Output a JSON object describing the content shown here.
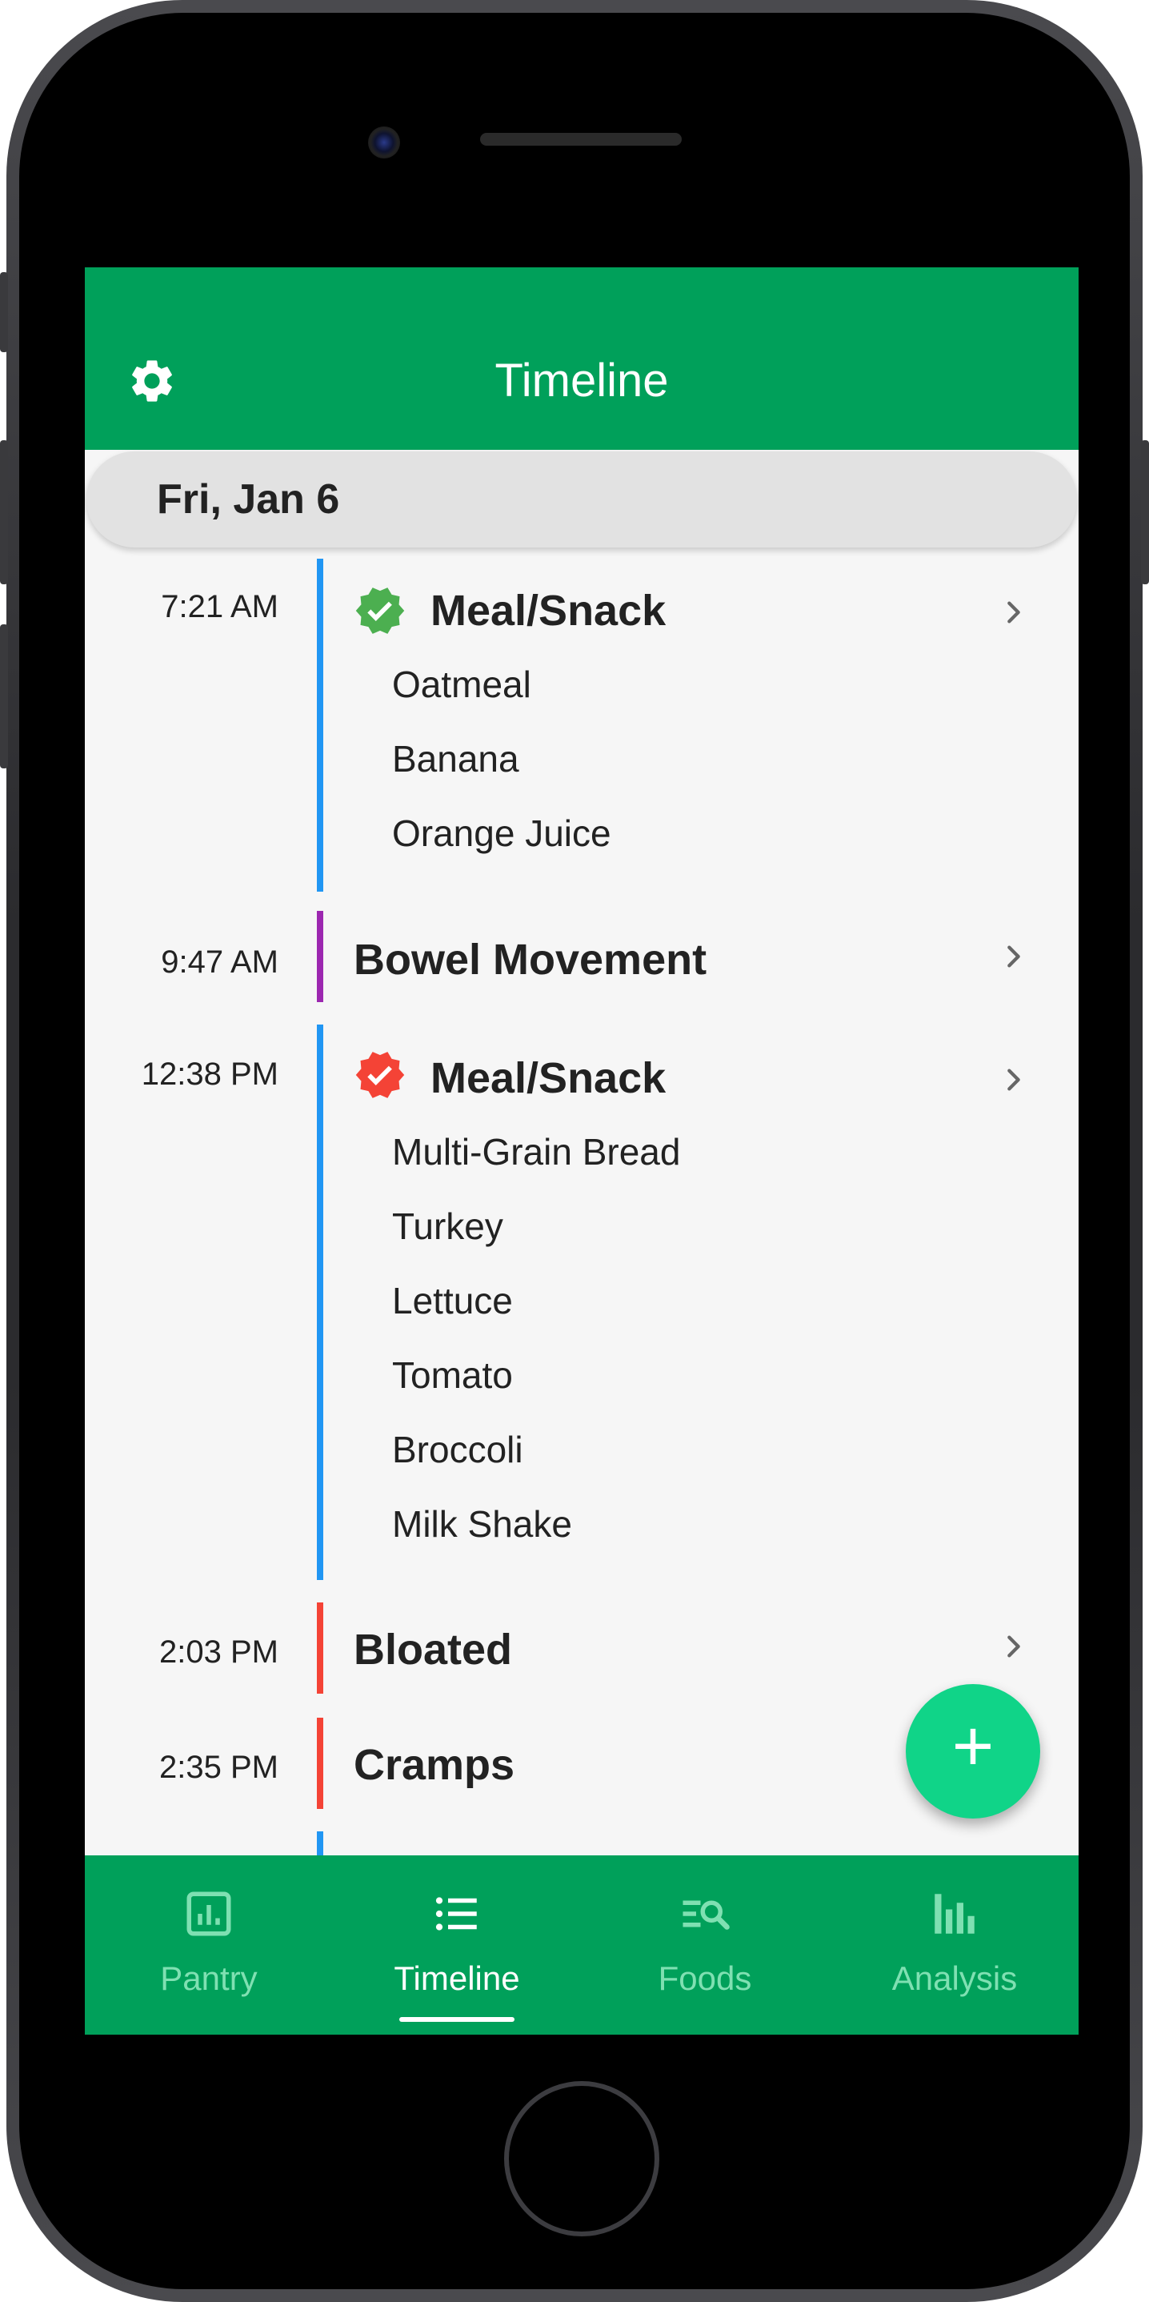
{
  "app_bar": {
    "title": "Timeline"
  },
  "date_header": "Fri, Jan 6",
  "entries": [
    {
      "time": "7:21 AM",
      "title": "Meal/Snack",
      "badge": "check-badge-icon",
      "badge_color": "#4caf50",
      "bar_color": "#2196f3",
      "foods": [
        "Oatmeal",
        "Banana",
        "Orange Juice"
      ]
    },
    {
      "time": "9:47 AM",
      "title": "Bowel Movement",
      "bar_color": "#9c27b0"
    },
    {
      "time": "12:38 PM",
      "title": "Meal/Snack",
      "badge": "check-badge-icon",
      "badge_color": "#f44336",
      "bar_color": "#2196f3",
      "foods": [
        "Multi-Grain Bread",
        "Turkey",
        "Lettuce",
        "Tomato",
        "Broccoli",
        "Milk Shake"
      ]
    },
    {
      "time": "2:03 PM",
      "title": "Bloated",
      "bar_color": "#f44336"
    },
    {
      "time": "2:35 PM",
      "title": "Cramps",
      "bar_color": "#f44336"
    }
  ],
  "fab": {
    "label": "+"
  },
  "bottom_nav": [
    {
      "label": "Pantry",
      "icon": "chart-box-icon",
      "active": false
    },
    {
      "label": "Timeline",
      "icon": "list-icon",
      "active": true
    },
    {
      "label": "Foods",
      "icon": "search-list-icon",
      "active": false
    },
    {
      "label": "Analysis",
      "icon": "bar-chart-icon",
      "active": false
    }
  ],
  "colors": {
    "primary": "#00a05a",
    "fab": "#10d488",
    "inactive_nav": "#7fe0b2"
  }
}
